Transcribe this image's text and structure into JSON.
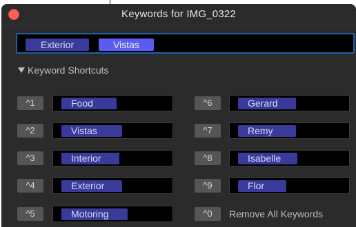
{
  "window": {
    "title": "Keywords for IMG_0322"
  },
  "keyword_field": {
    "tags": [
      "Exterior",
      "Vistas"
    ]
  },
  "shortcuts_section": {
    "label": "Keyword Shortcuts",
    "expanded": true
  },
  "shortcuts": [
    {
      "key": "^1",
      "keyword": "Food"
    },
    {
      "key": "^2",
      "keyword": "Vistas"
    },
    {
      "key": "^3",
      "keyword": "Interior"
    },
    {
      "key": "^4",
      "keyword": "Exterior"
    },
    {
      "key": "^5",
      "keyword": "Motoring"
    },
    {
      "key": "^6",
      "keyword": "Gerard"
    },
    {
      "key": "^7",
      "keyword": "Remy"
    },
    {
      "key": "^8",
      "keyword": "Isabelle"
    },
    {
      "key": "^9",
      "keyword": "Flor"
    }
  ],
  "remove_all": {
    "key": "^0",
    "label": "Remove All Keywords"
  },
  "colors": {
    "window_bg": "#2b2b2b",
    "field_border": "#1f5fa8",
    "tag_bg": "#3a3a9a",
    "tag_selected_bg": "#5b5bf0",
    "close_button": "#ff5f57"
  }
}
